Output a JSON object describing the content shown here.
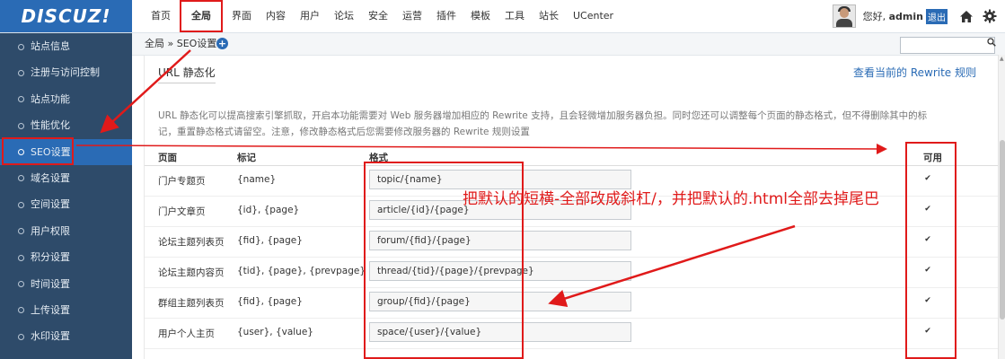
{
  "app": {
    "logo": "DISCUZ!"
  },
  "nav": {
    "items": [
      "首页",
      "全局",
      "界面",
      "内容",
      "用户",
      "论坛",
      "安全",
      "运营",
      "插件",
      "模板",
      "工具",
      "站长",
      "UCenter"
    ],
    "active_index": 1
  },
  "user": {
    "greeting": "您好,",
    "name": "admin",
    "logout": "退出"
  },
  "icons": {
    "home": "home-icon",
    "settings": "gear-icon",
    "search": "search-icon",
    "add": "plus-icon"
  },
  "sidebar": {
    "items": [
      "站点信息",
      "注册与访问控制",
      "站点功能",
      "性能优化",
      "SEO设置",
      "域名设置",
      "空间设置",
      "用户权限",
      "积分设置",
      "时间设置",
      "上传设置",
      "水印设置"
    ],
    "active_index": 4
  },
  "breadcrumb": {
    "text": "全局 » SEO设置"
  },
  "search": {
    "value": "",
    "placeholder": ""
  },
  "section": {
    "title": "URL 静态化",
    "link": "查看当前的 Rewrite 规则",
    "description": "URL 静态化可以提高搜索引擎抓取，开启本功能需要对 Web 服务器增加相应的 Rewrite 支持，且会轻微增加服务器负担。同时您还可以调整每个页面的静态格式，但不得删除其中的标记，重置静态格式请留空。注意，修改静态格式后您需要修改服务器的 Rewrite 规则设置"
  },
  "table": {
    "headers": [
      "页面",
      "标记",
      "格式",
      "可用"
    ],
    "rows": [
      {
        "page": "门户专题页",
        "tags": "{name}",
        "format": "topic/{name}",
        "enabled": true
      },
      {
        "page": "门户文章页",
        "tags": "{id}, {page}",
        "format": "article/{id}/{page}",
        "enabled": true
      },
      {
        "page": "论坛主题列表页",
        "tags": "{fid}, {page}",
        "format": "forum/{fid}/{page}",
        "enabled": true
      },
      {
        "page": "论坛主题内容页",
        "tags": "{tid}, {page}, {prevpage}",
        "format": "thread/{tid}/{page}/{prevpage}",
        "enabled": true
      },
      {
        "page": "群组主题列表页",
        "tags": "{fid}, {page}",
        "format": "group/{fid}/{page}",
        "enabled": true
      },
      {
        "page": "用户个人主页",
        "tags": "{user}, {value}",
        "format": "space/{user}/{value}",
        "enabled": true
      }
    ]
  },
  "annotation": {
    "text": "把默认的短横-全部改成斜杠/，并把默认的.html全部去掉尾巴"
  },
  "colors": {
    "brand": "#2a6bb5",
    "sidebar_bg": "#2e4b6a",
    "annotation": "#e01a1a"
  }
}
